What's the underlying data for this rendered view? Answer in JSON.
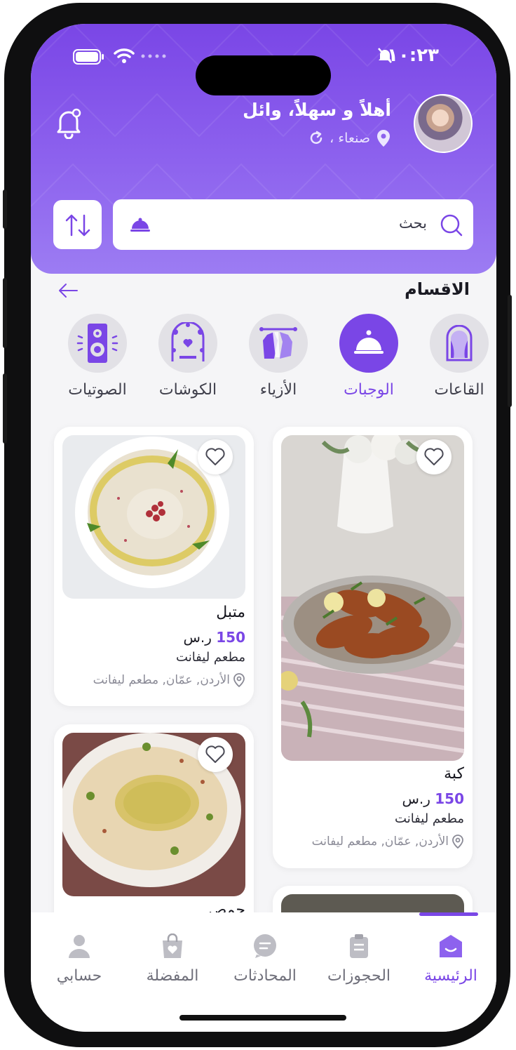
{
  "status": {
    "time": "١٠:٢٣"
  },
  "header": {
    "greeting": "أهلاً و سهلاً، وائل",
    "location": "صنعاء ،"
  },
  "search": {
    "label": "بحث"
  },
  "categories_section": {
    "title": "الاقسام",
    "items": [
      {
        "label": "القاعات",
        "icon": "hall-arch-icon",
        "active": false
      },
      {
        "label": "الوجبات",
        "icon": "food-cloche-icon",
        "active": true
      },
      {
        "label": "الأزياء",
        "icon": "clothes-rack-icon",
        "active": false
      },
      {
        "label": "الكوشات",
        "icon": "wedding-stage-icon",
        "active": false
      },
      {
        "label": "الصوتيات",
        "icon": "speaker-icon",
        "active": false
      }
    ]
  },
  "products": [
    {
      "title": "كبة",
      "price": "150",
      "currency": "ر.س",
      "restaurant": "مطعم ليفانت",
      "address": "الأردن, عمّان, مطعم ليفانت"
    },
    {
      "title": "متبل",
      "price": "150",
      "currency": "ر.س",
      "restaurant": "مطعم ليفانت",
      "address": "الأردن, عمّان, مطعم ليفانت"
    },
    {
      "title": "حمص"
    }
  ],
  "tabbar": {
    "items": [
      {
        "label": "الرئيسية",
        "icon": "home-icon",
        "active": true
      },
      {
        "label": "الحجوزات",
        "icon": "clipboard-icon",
        "active": false
      },
      {
        "label": "المحادثات",
        "icon": "chat-icon",
        "active": false
      },
      {
        "label": "المفضلة",
        "icon": "favorites-bag-icon",
        "active": false
      },
      {
        "label": "حسابي",
        "icon": "user-icon",
        "active": false
      }
    ]
  },
  "colors": {
    "accent": "#7a46e6",
    "background": "#f5f5f7"
  }
}
